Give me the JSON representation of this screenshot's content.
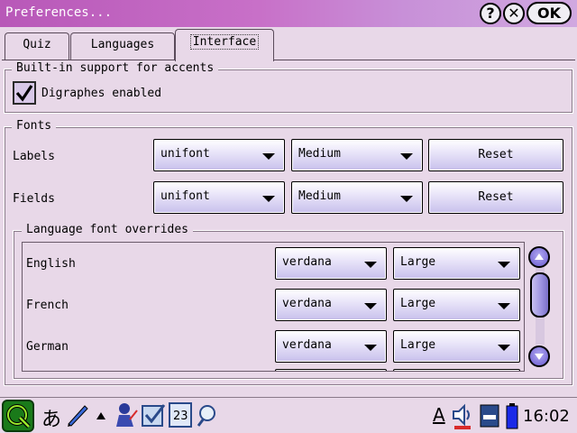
{
  "window": {
    "title": "Preferences...",
    "help_label": "?",
    "close_label": "✕",
    "ok_label": "OK"
  },
  "tabs": [
    {
      "label": "Quiz",
      "active": false
    },
    {
      "label": "Languages",
      "active": false
    },
    {
      "label": "Interface",
      "active": true
    }
  ],
  "accents": {
    "legend": "Built-in support for accents",
    "checkbox_label": "Digraphes enabled",
    "checked": true
  },
  "fonts": {
    "legend": "Fonts",
    "rows": [
      {
        "label": "Labels",
        "font": "unifont",
        "size": "Medium",
        "reset_label": "Reset"
      },
      {
        "label": "Fields",
        "font": "unifont",
        "size": "Medium",
        "reset_label": "Reset"
      }
    ]
  },
  "overrides": {
    "legend": "Language font overrides",
    "rows": [
      {
        "language": "English",
        "font": "verdana",
        "size": "Large"
      },
      {
        "language": "French",
        "font": "verdana",
        "size": "Large"
      },
      {
        "language": "German",
        "font": "verdana",
        "size": "Large"
      }
    ]
  },
  "taskbar": {
    "hiragana": "あ",
    "keyboard_letter": "A",
    "clock": "16:02",
    "calendar_day": "23"
  },
  "colors": {
    "titlebar_start": "#b858b8",
    "titlebar_end": "#d0a8e0",
    "background": "#e8d8e8",
    "accent": "#6a5ad0"
  }
}
